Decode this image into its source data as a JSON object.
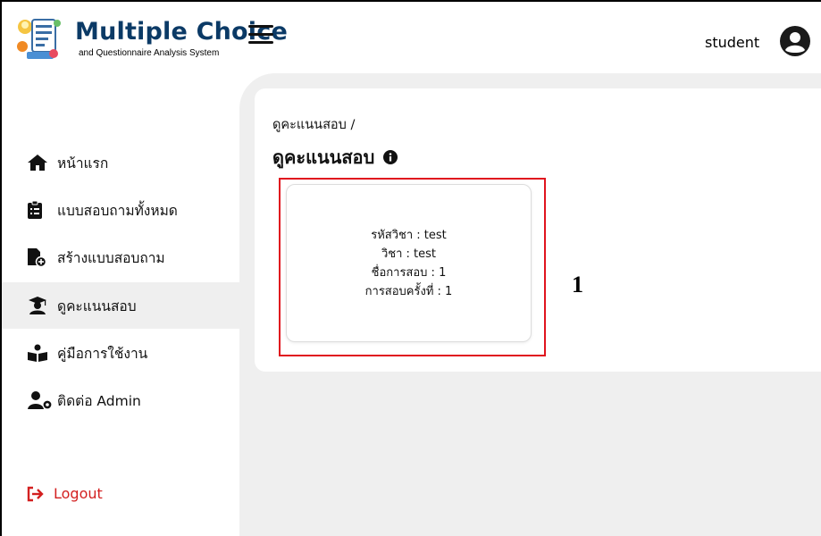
{
  "header": {
    "app_title": "Multiple Choice",
    "app_subtitle": "and Questionnaire Analysis System",
    "logo_icon": "quiz-document-icon",
    "menu_icon": "hamburger-icon",
    "user_name": "student",
    "avatar_icon": "user-circle-icon"
  },
  "sidebar": {
    "items": [
      {
        "label": "หน้าแรก",
        "icon": "home-icon"
      },
      {
        "label": "แบบสอบถามทั้งหมด",
        "icon": "clipboard-list-icon"
      },
      {
        "label": "สร้างแบบสอบถาม",
        "icon": "file-plus-icon"
      },
      {
        "label": "ดูคะแนนสอบ",
        "icon": "graduate-icon",
        "active": true
      },
      {
        "label": "คู่มือการใช้งาน",
        "icon": "book-reader-icon"
      },
      {
        "label": "ติดต่อ Admin",
        "icon": "user-gear-icon"
      }
    ],
    "logout_label": "Logout",
    "logout_icon": "logout-arrow-icon"
  },
  "main": {
    "breadcrumb": "ดูคะแนนสอบ /",
    "title": "ดูคะแนนสอบ",
    "title_icon": "info-circle-icon",
    "card": {
      "subject_code": "รหัสวิชา : test",
      "subject": "วิชา : test",
      "exam_name": "ชื่อการสอบ : 1",
      "exam_round": "การสอบครั้งที่ : 1"
    },
    "annotation": "1"
  },
  "colors": {
    "brand_title": "#0b3a66",
    "logout": "#d32020",
    "highlight": "#e0141e",
    "content_bg": "#efefef"
  }
}
